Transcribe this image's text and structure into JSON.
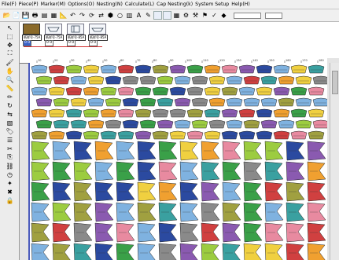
{
  "menu": [
    "File(F)",
    "Piece(P)",
    "Marker(M)",
    "Options(O)",
    "Nesting(N)",
    "Calculate(L)",
    "Cap Nesting(k)",
    "System Setup",
    "Help(H)"
  ],
  "toolbar": {
    "icons": [
      "open-icon",
      "open-folder-icon",
      "save-icon",
      "print-icon",
      "plot-icon",
      "zoom-icon",
      "undo-icon",
      "redo-icon",
      "measure-icon",
      "rotate-icon",
      "flip-icon",
      "nest-icon",
      "text-icon",
      "ruler-icon",
      "grid-icon",
      "color-icon",
      "layout-icon",
      "piece-icon",
      "check-icon",
      "settings-icon"
    ],
    "field1": "",
    "field2": ""
  },
  "pieces": {
    "codes": [
      "纸样号-75A",
      "纸样号-75A",
      "纸样号-85A",
      "纸样号-85A"
    ],
    "counts": [
      "0 0",
      "0 0",
      "0 0",
      "0 0"
    ]
  },
  "ruler": {
    "ticks": [
      "10",
      "20",
      "30",
      "40",
      "50",
      "60",
      "70",
      "80",
      "90",
      "100",
      "110",
      "120",
      "130",
      "140",
      "150",
      "160",
      "170",
      "180"
    ]
  },
  "colors": {
    "blue": "#2b4aa0",
    "lightblue": "#7fb2e0",
    "green": "#3aa048",
    "lime": "#9ccc40",
    "yellow": "#f0d040",
    "orange": "#f0a030",
    "red": "#d04040",
    "pink": "#e88aa0",
    "purple": "#8a5ab0",
    "teal": "#3aa0a0",
    "olive": "#a0a040",
    "gray": "#8a8a8a"
  }
}
